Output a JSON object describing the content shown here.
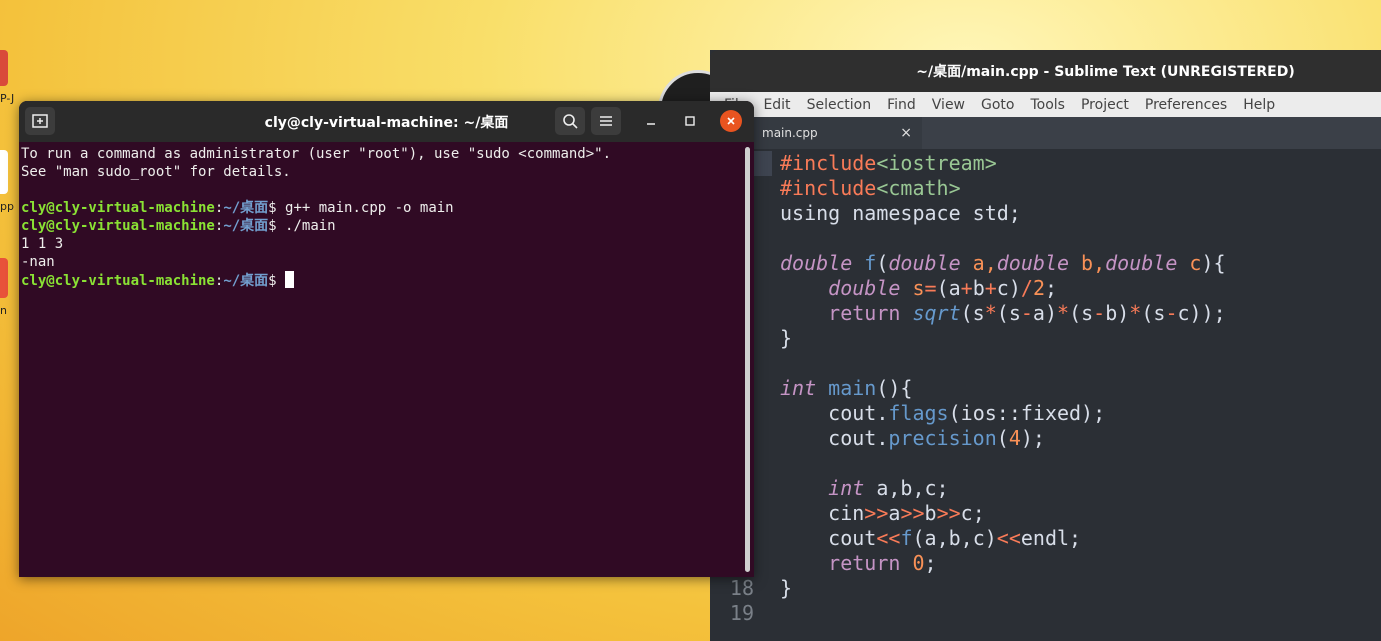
{
  "desktop": {
    "label_1": "P-J",
    "label_2": "pp",
    "label_3": "n"
  },
  "sublime": {
    "title": "~/桌面/main.cpp - Sublime Text (UNREGISTERED)",
    "menu": [
      "File",
      "Edit",
      "Selection",
      "Find",
      "View",
      "Goto",
      "Tools",
      "Project",
      "Preferences",
      "Help"
    ],
    "tab_label": "main.cpp",
    "tab_close": "×",
    "line_numbers": [
      "",
      "",
      "",
      "",
      "",
      "",
      "",
      "",
      "",
      "",
      "",
      "",
      "",
      "",
      "",
      "",
      "",
      "18",
      "19"
    ],
    "code": {
      "l1_a": "#include",
      "l1_b": "<iostream>",
      "l2_a": "#include",
      "l2_b": "<cmath>",
      "l3": "using namespace std;",
      "l5_double": "double",
      "l5_f": "f",
      "l5_rest_open": "(",
      "l5_d1": "double",
      "l5_a": " a,",
      "l5_d2": "double",
      "l5_b": " b,",
      "l5_d3": "double",
      "l5_c": " c",
      "l5_close": "){",
      "l6_double": "double",
      "l6_s": " s",
      "l6_eq": "=",
      "l6_expr1": "(a",
      "l6_p1": "+",
      "l6_expr2": "b",
      "l6_p2": "+",
      "l6_expr3": "c)",
      "l6_div": "/",
      "l6_two": "2",
      "l6_end": ";",
      "l7_ret": "return",
      "l7_sqrt": "sqrt",
      "l7_o": "(s",
      "l7_m1": "*",
      "l7_g1": "(s",
      "l7_mi1": "-",
      "l7_a": "a)",
      "l7_m2": "*",
      "l7_g2": "(s",
      "l7_mi2": "-",
      "l7_b": "b)",
      "l7_m3": "*",
      "l7_g3": "(s",
      "l7_mi3": "-",
      "l7_c": "c));",
      "l8": "}",
      "l10_int": "int",
      "l10_main": "main",
      "l10_rest": "(){",
      "l11_cout": "cout.",
      "l11_flags": "flags",
      "l11_rest": "(ios::fixed);",
      "l12_cout": "cout.",
      "l12_prec": "precision",
      "l12_open": "(",
      "l12_num": "4",
      "l12_close": ");",
      "l14_int": "int",
      "l14_rest": " a,b,c;",
      "l15_cin": "cin",
      "l15_op1": ">>",
      "l15_a": "a",
      "l15_op2": ">>",
      "l15_b": "b",
      "l15_op3": ">>",
      "l15_c": "c;",
      "l16_cout": "cout",
      "l16_op1": "<<",
      "l16_f": "f",
      "l16_args": "(a,b,c)",
      "l16_op2": "<<",
      "l16_end": "endl;",
      "l17_ret": "return",
      "l17_zero": "0",
      "l17_end": ";",
      "l18": "}"
    }
  },
  "terminal": {
    "title": "cly@cly-virtual-machine: ~/桌面",
    "line1": "To run a command as administrator (user \"root\"), use \"sudo <command>\".",
    "line2": "See \"man sudo_root\" for details.",
    "prompt_user": "cly@cly-virtual-machine",
    "prompt_colon": ":",
    "prompt_path": "~/桌面",
    "prompt_dollar": "$ ",
    "cmd1": "g++ main.cpp -o main",
    "cmd2": "./main",
    "out1": "1 1 3",
    "out2": "-nan"
  }
}
